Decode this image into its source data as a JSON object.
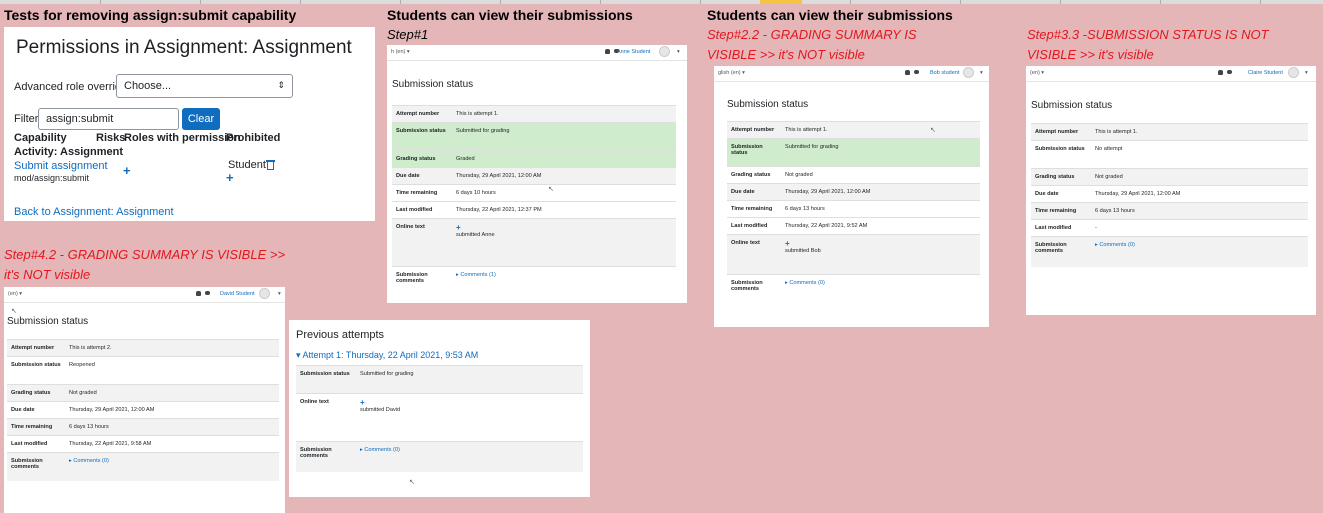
{
  "headings": {
    "tests_title": "Tests for removing assign:submit capability",
    "students_view_1": "Students can view their submissions",
    "students_view_2": "Students can view their submissions"
  },
  "steps": {
    "step1": "Step#1",
    "step22": "Step#2.2 - GRADING SUMMARY IS VISIBLE >> it's NOT visible",
    "step33": "Step#3.3 -SUBMISSION STATUS IS NOT VISIBLE >> it's visible",
    "step42": "Step#4.2 - GRADING SUMMARY IS VISIBLE >> it's NOT visible"
  },
  "permissions": {
    "title": "Permissions in Assignment: Assignment",
    "advanced_label": "Advanced role override",
    "select_value": "Choose...",
    "filter_label": "Filter",
    "filter_value": "assign:submit",
    "clear_button": "Clear",
    "col_capability": "Capability",
    "col_risks": "Risks",
    "col_roles": "Roles with permission",
    "col_prohibited": "Prohibited",
    "activity": "Activity: Assignment",
    "cap_name": "Submit assignment",
    "cap_code": "mod/assign:submit",
    "role": "Student",
    "back_link": "Back to Assignment: Assignment"
  },
  "common": {
    "submission_status": "Submission status",
    "lang": "(en) ▾"
  },
  "anne": {
    "lang": "h (en) ▾",
    "user": "Anne Student",
    "rows": [
      {
        "k": "Attempt number",
        "v": "This is attempt 1."
      },
      {
        "k": "Submission status",
        "v": "Submitted for grading"
      },
      {
        "k": "Grading status",
        "v": "Graded"
      },
      {
        "k": "Due date",
        "v": "Thursday, 29 April 2021, 12:00 AM"
      },
      {
        "k": "Time remaining",
        "v": "6 days 10 hours"
      },
      {
        "k": "Last modified",
        "v": "Thursday, 22 April 2021, 12:37 PM"
      },
      {
        "k": "Online text",
        "v": "submitted Anne"
      },
      {
        "k": "Submission comments",
        "v": "Comments (1)"
      }
    ]
  },
  "bob": {
    "lang": "glish (en) ▾",
    "user": "Bob student",
    "rows": [
      {
        "k": "Attempt number",
        "v": "This is attempt 1."
      },
      {
        "k": "Submission status",
        "v": "Submitted for grading"
      },
      {
        "k": "Grading status",
        "v": "Not graded"
      },
      {
        "k": "Due date",
        "v": "Thursday, 29 April 2021, 12:00 AM"
      },
      {
        "k": "Time remaining",
        "v": "6 days 13 hours"
      },
      {
        "k": "Last modified",
        "v": "Thursday, 22 April 2021, 9:52 AM"
      },
      {
        "k": "Online text",
        "v": "submitted Bob"
      },
      {
        "k": "Submission comments",
        "v": "Comments (0)"
      }
    ]
  },
  "claire": {
    "lang": "(en) ▾",
    "user": "Claire Student",
    "rows": [
      {
        "k": "Attempt number",
        "v": "This is attempt 1."
      },
      {
        "k": "Submission status",
        "v": "No attempt"
      },
      {
        "k": "Grading status",
        "v": "Not graded"
      },
      {
        "k": "Due date",
        "v": "Thursday, 29 April 2021, 12:00 AM"
      },
      {
        "k": "Time remaining",
        "v": "6 days 13 hours"
      },
      {
        "k": "Last modified",
        "v": "-"
      },
      {
        "k": "Submission comments",
        "v": "Comments (0)"
      }
    ]
  },
  "david": {
    "lang": "(en) ▾",
    "user": "David Student",
    "rows": [
      {
        "k": "Attempt number",
        "v": "This is attempt 2."
      },
      {
        "k": "Submission status",
        "v": "Reopened"
      },
      {
        "k": "Grading status",
        "v": "Not graded"
      },
      {
        "k": "Due date",
        "v": "Thursday, 29 April 2021, 12:00 AM"
      },
      {
        "k": "Time remaining",
        "v": "6 days 13 hours"
      },
      {
        "k": "Last modified",
        "v": "Thursday, 22 April 2021, 9:58 AM"
      },
      {
        "k": "Submission comments",
        "v": "Comments (0)"
      }
    ]
  },
  "previous": {
    "title": "Previous attempts",
    "attempt": "Attempt 1: Thursday, 22 April 2021, 9:53 AM",
    "rows": [
      {
        "k": "Submission status",
        "v": "Submitted for grading"
      },
      {
        "k": "Online text",
        "v": "submitted David"
      },
      {
        "k": "Submission comments",
        "v": "Comments (0)"
      }
    ]
  }
}
